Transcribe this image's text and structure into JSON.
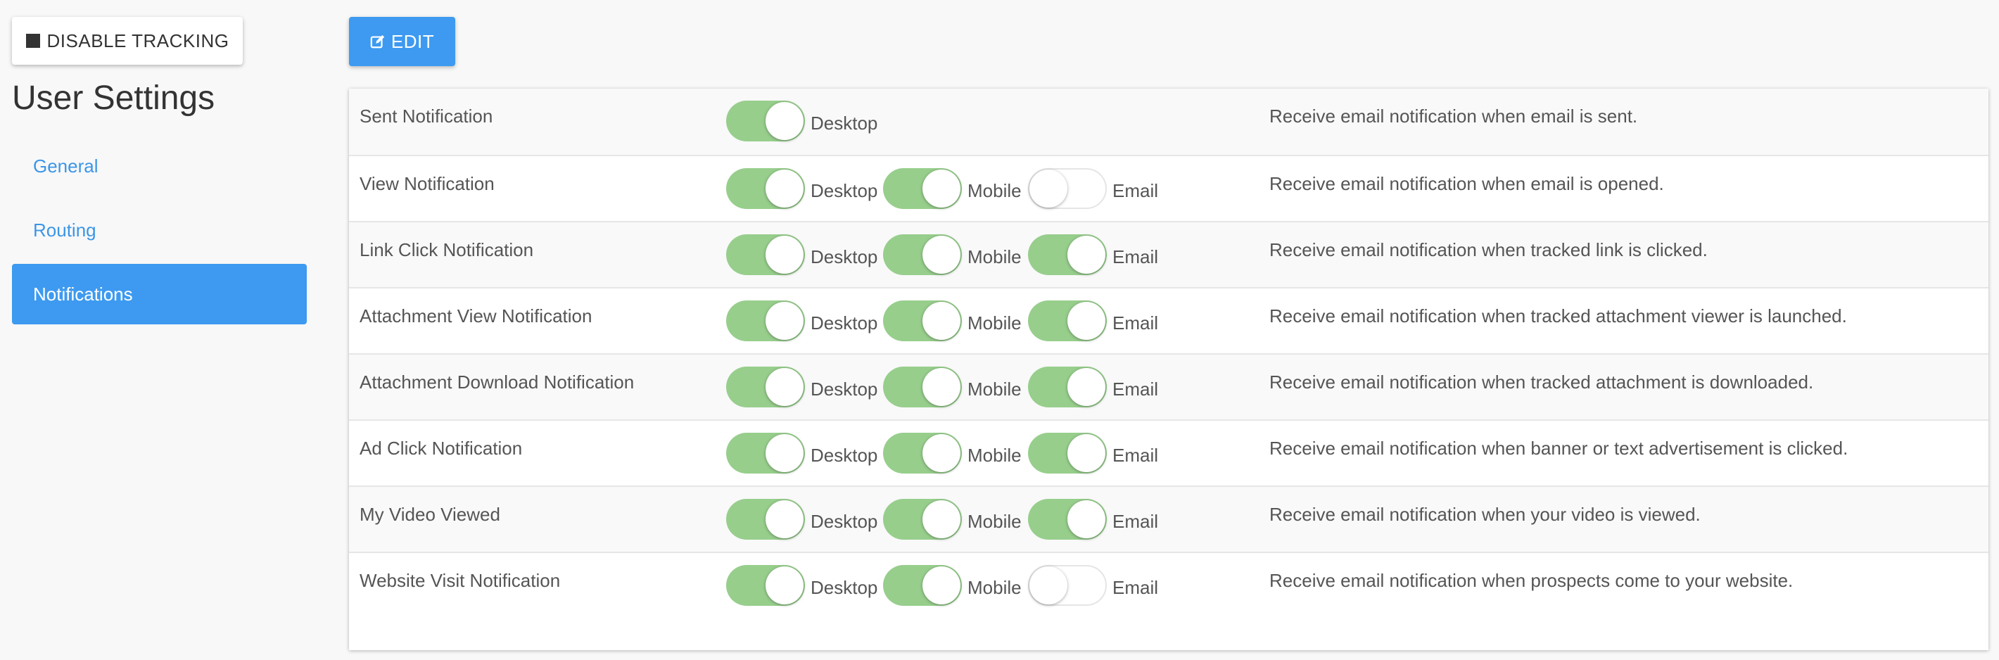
{
  "sidebar": {
    "disable_tracking_label": "DISABLE TRACKING",
    "title": "User Settings",
    "nav": [
      {
        "label": "General",
        "active": false
      },
      {
        "label": "Routing",
        "active": false
      },
      {
        "label": "Notifications",
        "active": true
      }
    ]
  },
  "toolbar": {
    "edit_label": "EDIT"
  },
  "toggle_labels": {
    "desktop": "Desktop",
    "mobile": "Mobile",
    "email": "Email"
  },
  "notifications": [
    {
      "label": "Sent Notification",
      "desktop": true,
      "mobile": null,
      "email": null,
      "description": "Receive email notification when email is sent."
    },
    {
      "label": "View Notification",
      "desktop": true,
      "mobile": true,
      "email": false,
      "description": "Receive email notification when email is opened."
    },
    {
      "label": "Link Click Notification",
      "desktop": true,
      "mobile": true,
      "email": true,
      "description": "Receive email notification when tracked link is clicked."
    },
    {
      "label": "Attachment View Notification",
      "desktop": true,
      "mobile": true,
      "email": true,
      "description": "Receive email notification when tracked attachment viewer is launched."
    },
    {
      "label": "Attachment Download Notification",
      "desktop": true,
      "mobile": true,
      "email": true,
      "description": "Receive email notification when tracked attachment is downloaded."
    },
    {
      "label": "Ad Click Notification",
      "desktop": true,
      "mobile": true,
      "email": true,
      "description": "Receive email notification when banner or text advertisement is clicked."
    },
    {
      "label": "My Video Viewed",
      "desktop": true,
      "mobile": true,
      "email": true,
      "description": "Receive email notification when your video is viewed."
    },
    {
      "label": "Website Visit Notification",
      "desktop": true,
      "mobile": true,
      "email": false,
      "description": "Receive email notification when prospects come to your website."
    }
  ],
  "colors": {
    "accent": "#3d9af0",
    "toggle_on": "#97ce8c",
    "link": "#3c96e6"
  }
}
